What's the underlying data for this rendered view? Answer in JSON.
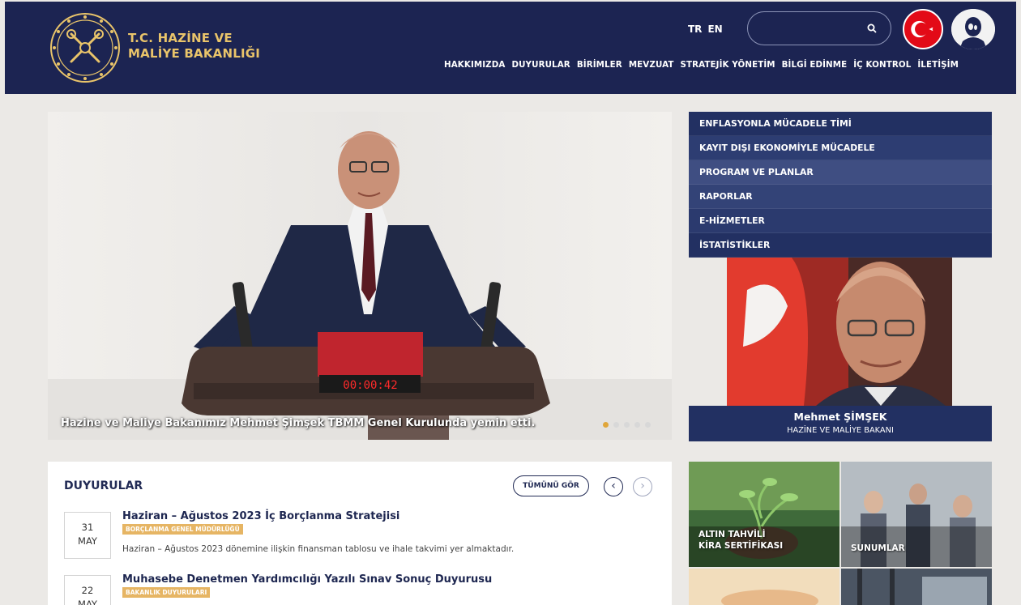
{
  "header": {
    "logo_line1": "T.C. HAZİNE VE",
    "logo_line2": "MALİYE BAKANLIĞI",
    "lang_tr": "TR",
    "lang_en": "EN",
    "search_placeholder": "",
    "brand_color": "#1c2452",
    "accent_color": "#e9c46a"
  },
  "nav": [
    "HAKKIMIZDA",
    "DUYURULAR",
    "BİRİMLER",
    "MEVZUAT",
    "STRATEJİK YÖNETİM",
    "BİLGİ EDİNME",
    "İÇ KONTROL",
    "İLETİŞİM"
  ],
  "hero": {
    "caption": "Hazine ve Maliye Bakanımız Mehmet Şimşek TBMM Genel Kurulunda yemin etti.",
    "clock": "00:00:42",
    "slide_count": 5,
    "active_slide": 1
  },
  "side_menu": [
    "ENFLASYONLA MÜCADELE TİMİ",
    "KAYIT DIŞI EKONOMİYLE MÜCADELE",
    "PROGRAM VE PLANLAR",
    "RAPORLAR",
    "E-HİZMETLER",
    "İSTATİSTİKLER"
  ],
  "minister": {
    "name": "Mehmet ŞİMŞEK",
    "title": "HAZİNE VE MALİYE BAKANI"
  },
  "announcements": {
    "heading": "DUYURULAR",
    "all_button": "TÜMÜNÜ GÖR",
    "prev_icon": "‹",
    "next_icon": "›",
    "items": [
      {
        "day": "31",
        "month": "MAY",
        "title": "Haziran – Ağustos 2023 İç Borçlanma Stratejisi",
        "badge": "BORÇLANMA GENEL MÜDÜRLÜĞÜ",
        "description": "Haziran – Ağustos 2023 dönemine ilişkin finansman tablosu ve ihale takvimi yer almaktadır."
      },
      {
        "day": "22",
        "month": "MAY",
        "title": "Muhasebe Denetmen Yardımcılığı Yazılı Sınav Sonuç Duyurusu",
        "badge": "BAKANLIK DUYURULARI",
        "description": ""
      }
    ]
  },
  "tiles": [
    {
      "label_line1": "ALTIN TAHVİLİ",
      "label_line2": "KİRA SERTİFİKASI"
    },
    {
      "label_line1": "SUNUMLAR",
      "label_line2": ""
    }
  ]
}
